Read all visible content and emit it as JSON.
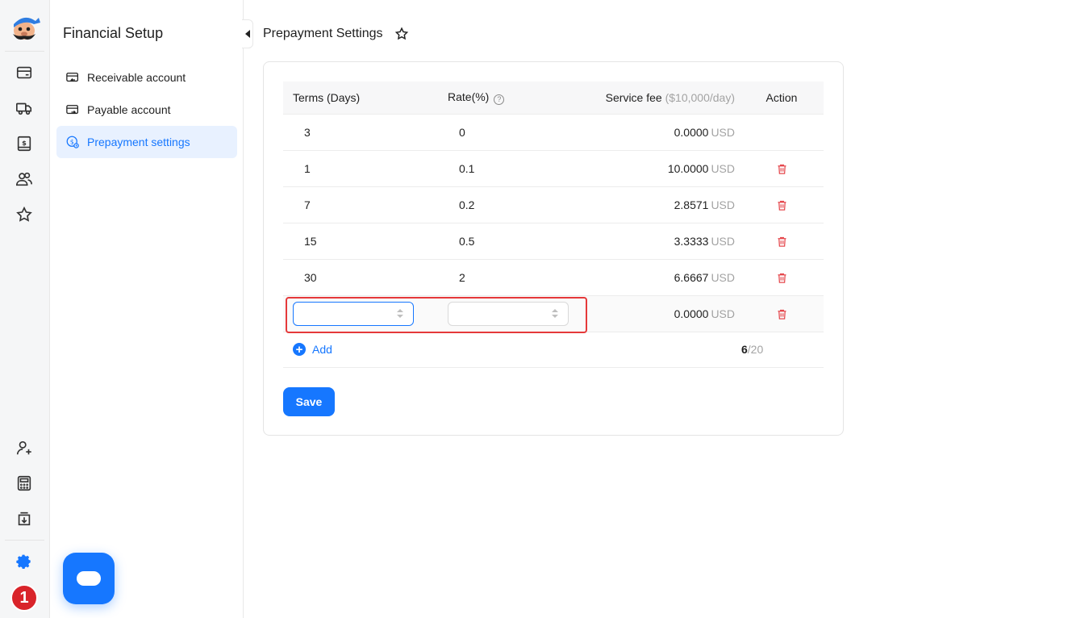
{
  "rail": {
    "items": [
      {
        "name": "card-icon",
        "top": 0
      },
      {
        "name": "truck-icon"
      },
      {
        "name": "invoice-icon"
      },
      {
        "name": "users-icon"
      },
      {
        "name": "star-icon"
      }
    ],
    "bottom_items": [
      "add-user-icon",
      "calculator-icon",
      "export-icon",
      "gear-icon"
    ],
    "notification_count": "1"
  },
  "subnav": {
    "title": "Financial Setup",
    "items": [
      {
        "label": "Receivable account",
        "icon": "receivable-card-icon",
        "active": false
      },
      {
        "label": "Payable account",
        "icon": "payable-card-icon",
        "active": false
      },
      {
        "label": "Prepayment settings",
        "icon": "prepayment-icon",
        "active": true
      }
    ]
  },
  "page": {
    "title": "Prepayment Settings"
  },
  "table": {
    "headers": {
      "terms": "Terms (Days)",
      "rate": "Rate(%)",
      "fee": "Service fee",
      "fee_hint": "($10,000/day)",
      "action": "Action"
    },
    "rows": [
      {
        "terms": "3",
        "rate": "0",
        "fee": "0.0000",
        "unit": "USD",
        "deletable": false
      },
      {
        "terms": "1",
        "rate": "0.1",
        "fee": "10.0000",
        "unit": "USD",
        "deletable": true
      },
      {
        "terms": "7",
        "rate": "0.2",
        "fee": "2.8571",
        "unit": "USD",
        "deletable": true
      },
      {
        "terms": "15",
        "rate": "0.5",
        "fee": "3.3333",
        "unit": "USD",
        "deletable": true
      },
      {
        "terms": "30",
        "rate": "2",
        "fee": "6.6667",
        "unit": "USD",
        "deletable": true
      }
    ],
    "new_row": {
      "terms_value": "",
      "rate_value": "",
      "fee": "0.0000",
      "unit": "USD"
    },
    "add_label": "Add",
    "count": "6",
    "count_max": "/20"
  },
  "save_label": "Save",
  "colors": {
    "accent": "#1677ff",
    "danger": "#e5484d",
    "highlight": "#e5393a"
  }
}
